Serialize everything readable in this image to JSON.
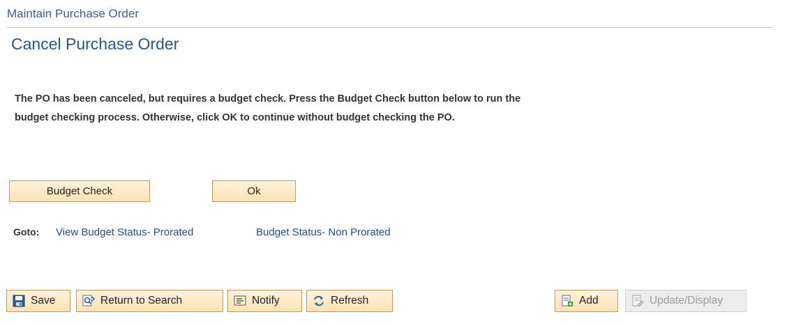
{
  "header": {
    "breadcrumb": "Maintain Purchase Order",
    "title": "Cancel Purchase Order"
  },
  "message": {
    "line1": "The PO has been canceled, but requires a budget check.  Press the Budget Check button below to run the",
    "line2": "budget checking process. Otherwise, click OK to continue without budget checking the PO."
  },
  "actions": {
    "budget_check_label": "Budget Check",
    "ok_label": "Ok"
  },
  "goto": {
    "label": "Goto:",
    "links": [
      {
        "label": "View Budget Status- Prorated"
      },
      {
        "label": "Budget Status- Non Prorated"
      }
    ]
  },
  "toolbar": {
    "save_label": "Save",
    "return_label": "Return to Search",
    "notify_label": "Notify",
    "refresh_label": "Refresh",
    "add_label": "Add",
    "update_label": "Update/Display"
  }
}
